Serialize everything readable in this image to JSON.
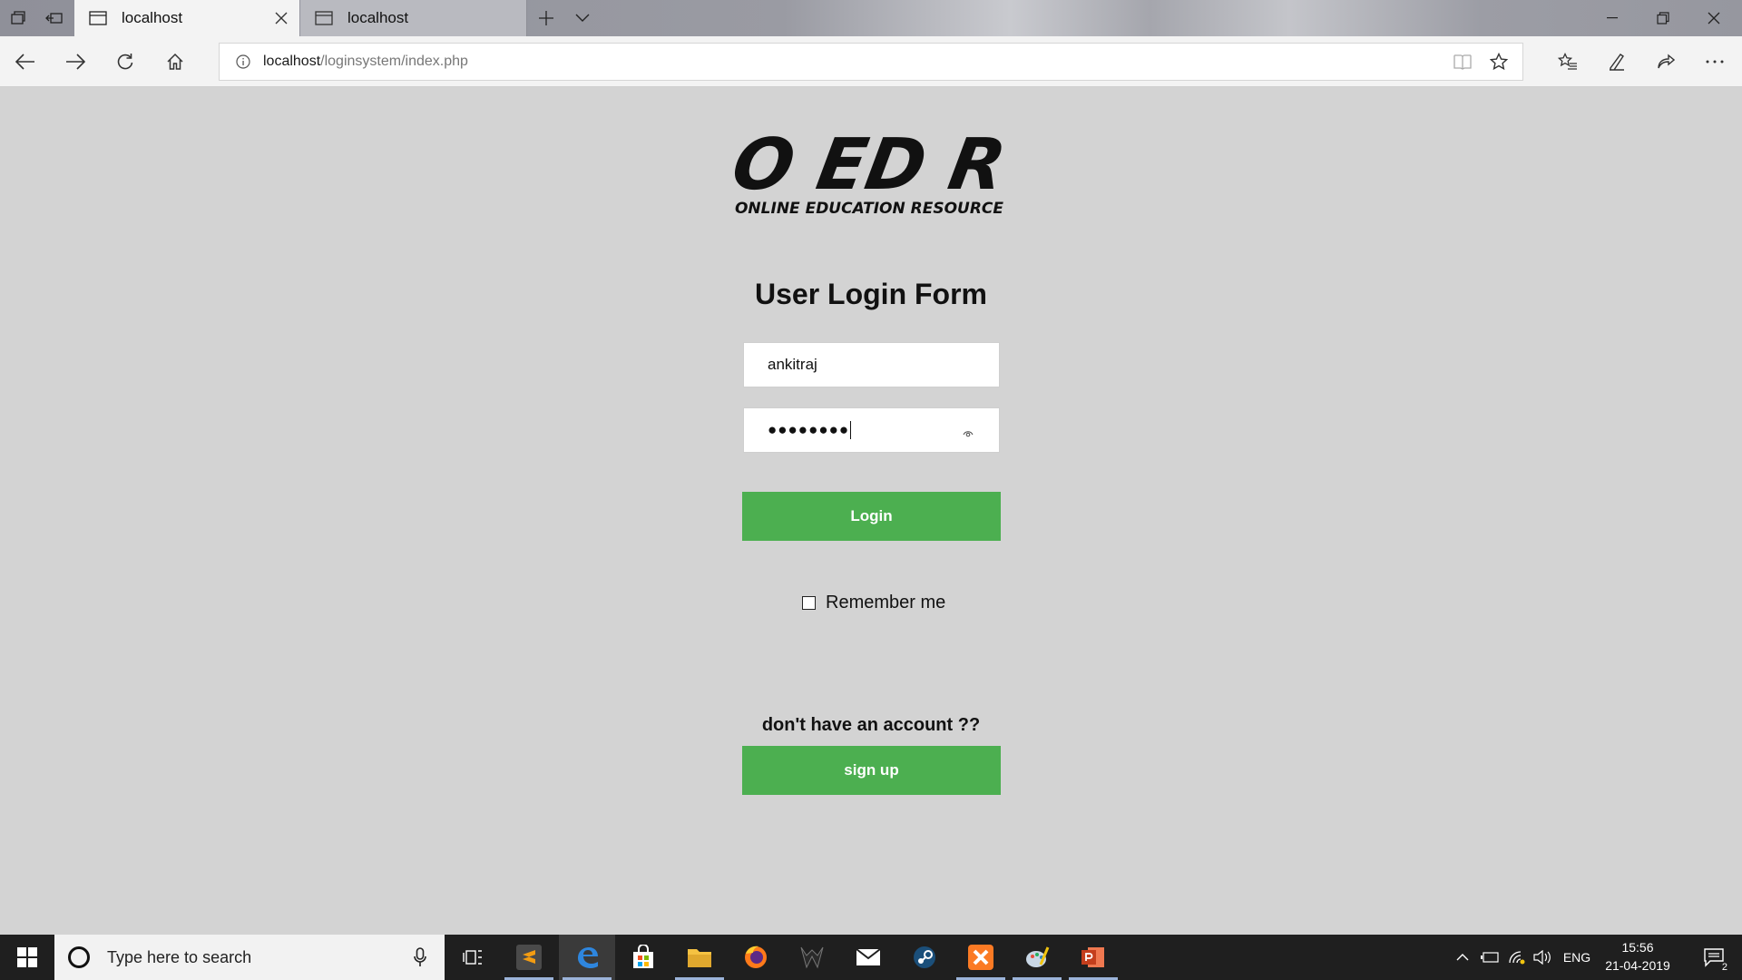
{
  "browser": {
    "tabs": [
      {
        "label": "localhost",
        "active": true
      },
      {
        "label": "localhost",
        "active": false
      }
    ],
    "address": {
      "host": "localhost",
      "path": "/loginsystem/index.php"
    }
  },
  "page": {
    "logo": {
      "letters": "O ED R",
      "tagline": "ONLINE EDUCATION RESOURCE"
    },
    "form_title": "User Login Form",
    "username_value": "ankitraj",
    "password_mask": "●●●●●●●●",
    "login_label": "Login",
    "remember_label": "Remember me",
    "signup_prompt": "don't have an account ??",
    "signup_label": "sign up",
    "colors": {
      "background": "#d3d3d3",
      "button": "#4caf50"
    }
  },
  "taskbar": {
    "search_placeholder": "Type here to search",
    "apps": [
      "sublime-text-icon",
      "edge-icon",
      "store-icon",
      "file-explorer-icon",
      "firefox-icon",
      "predator-icon",
      "mail-icon",
      "steam-icon",
      "xampp-icon",
      "paint-icon",
      "powerpoint-icon"
    ],
    "language": "ENG",
    "time": "15:56",
    "date": "21-04-2019",
    "notification_count": "2"
  }
}
